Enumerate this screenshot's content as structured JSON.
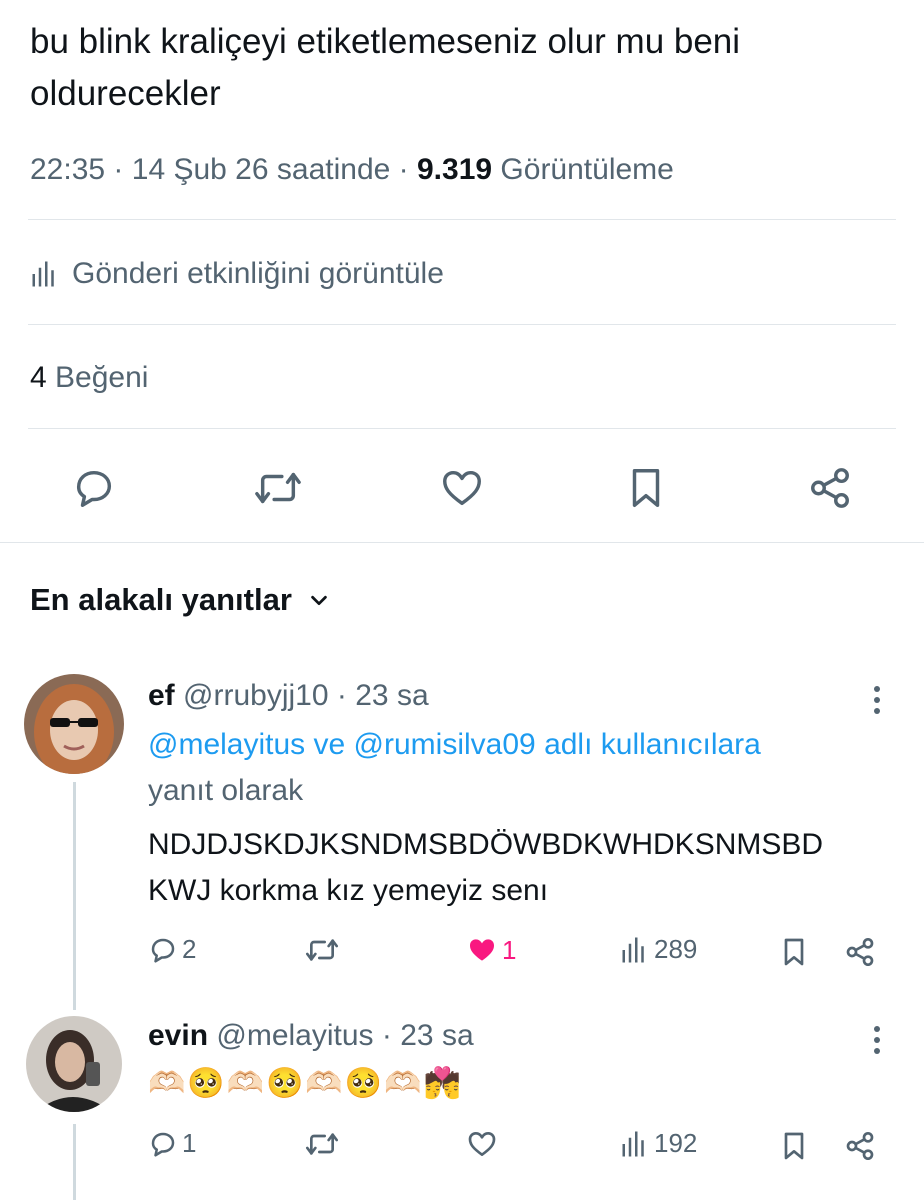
{
  "tweet": {
    "text": "bu blink kraliçeyi etiketlemeseniz olur mu beni oldurecekler",
    "time": "22:35",
    "sep1": "·",
    "date": "14 Şub 26 saatinde",
    "sep2": "·",
    "views_count": "9.319",
    "views_label": "Görüntüleme",
    "activity_label": "Gönderi etkinliğini görüntüle",
    "likes_count": "4",
    "likes_label": "Beğeni"
  },
  "replies_sort": {
    "label": "En alakalı yanıtlar"
  },
  "replies": [
    {
      "name": "ef",
      "handle": "@rrubyjj10",
      "sep": "·",
      "time": "23 sa",
      "mention1": "@melayitus",
      "mention_and": "ve",
      "mention2": "@rumisilva09",
      "mention_suffix": "adlı kullanıcılara",
      "reply_to_label": "yanıt olarak",
      "text_line1": "NDJDJSKDJKSNDMSBDÖWBDKWHDKSNMSBD",
      "text_line2": "KWJ korkma kız yemeyiz senı",
      "reply_count": "2",
      "like_count": "1",
      "view_count": "289",
      "liked": true
    },
    {
      "name": "evin",
      "handle": "@melayitus",
      "sep": "·",
      "time": "23 sa",
      "text": "🫶🏻🥺🫶🏻🥺🫶🏻🥺🫶🏻💏",
      "reply_count": "1",
      "view_count": "192",
      "liked": false
    }
  ],
  "colors": {
    "accent": "#1d9bf0",
    "like_active": "#f91880",
    "text_primary": "#0f1419",
    "text_secondary": "#536471",
    "divider": "#e1e6ea"
  },
  "icons": {
    "reply": "reply-icon",
    "retweet": "retweet-icon",
    "like": "heart-icon",
    "bookmark": "bookmark-icon",
    "share": "share-icon",
    "analytics": "bar-chart-icon",
    "more": "more-vertical-icon",
    "chevron": "chevron-down-icon"
  }
}
